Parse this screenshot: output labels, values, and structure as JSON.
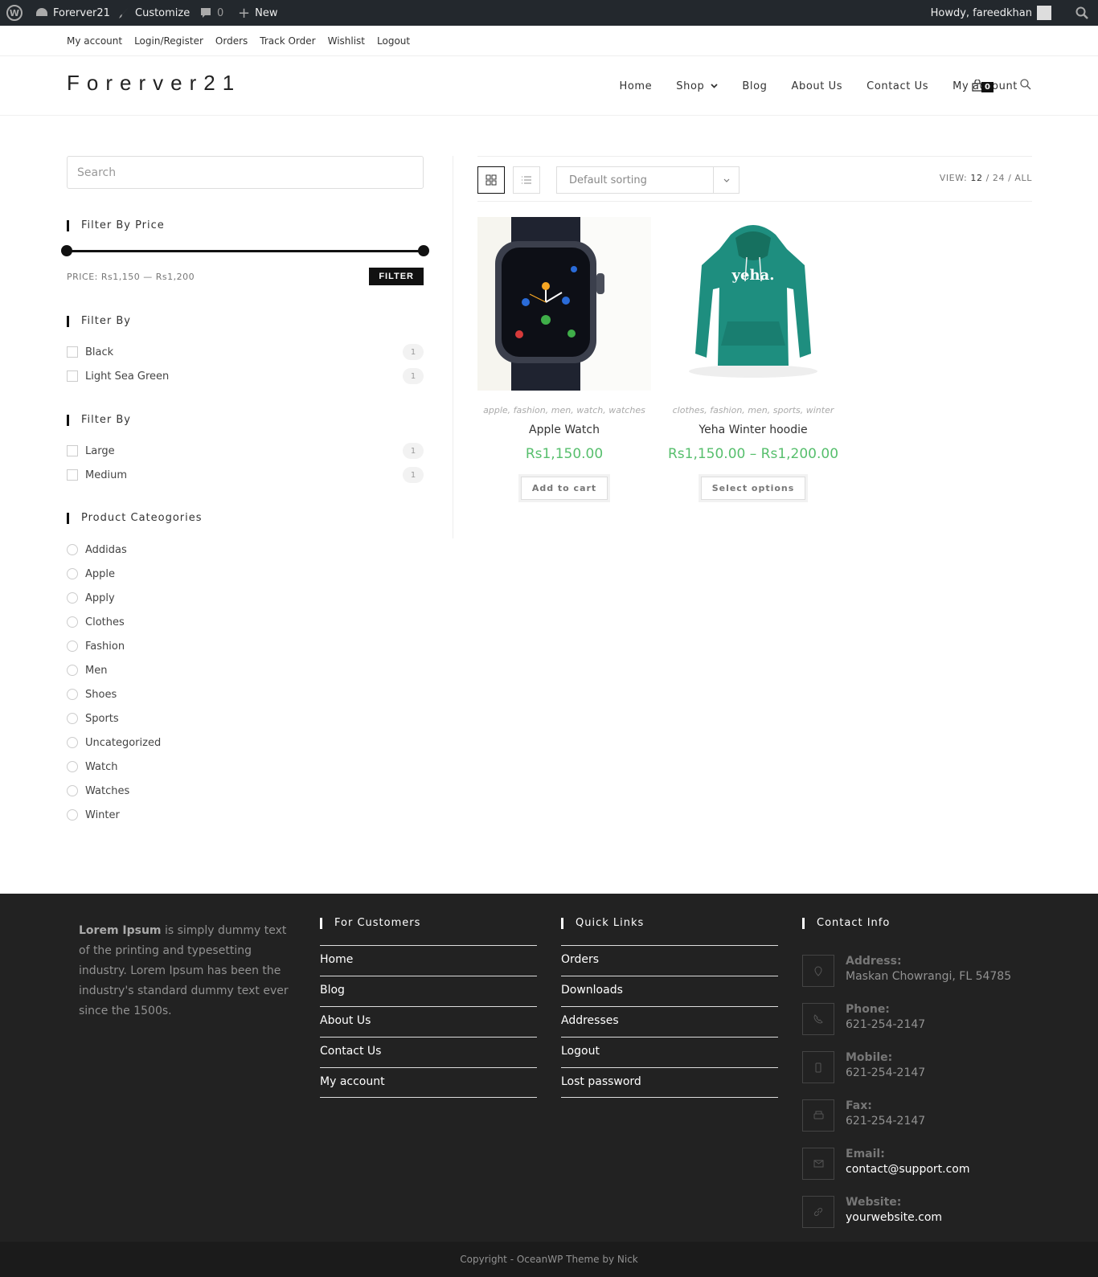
{
  "adminbar": {
    "site_name": "Forerver21",
    "customize": "Customize",
    "comments_count": "0",
    "new_label": "New",
    "howdy": "Howdy, fareedkhan"
  },
  "topbar": {
    "links": [
      "My account",
      "Login/Register",
      "Orders",
      "Track Order",
      "Wishlist",
      "Logout"
    ]
  },
  "header": {
    "logo": "Forerver21",
    "nav": [
      "Home",
      "Shop",
      "Blog",
      "About Us",
      "Contact Us",
      "My account"
    ],
    "cart_count": "0"
  },
  "sidebar": {
    "search_placeholder": "Search",
    "price_title": "Filter By Price",
    "price_label": "PRICE: Rs1,150 — Rs1,200",
    "price_range": [
      0,
      1
    ],
    "filter_button": "FILTER",
    "filter1_title": "Filter By",
    "filter1_items": [
      {
        "label": "Black",
        "count": "1"
      },
      {
        "label": "Light Sea Green",
        "count": "1"
      }
    ],
    "filter2_title": "Filter By",
    "filter2_items": [
      {
        "label": "Large",
        "count": "1"
      },
      {
        "label": "Medium",
        "count": "1"
      }
    ],
    "categories_title": "Product Cateogories",
    "categories": [
      "Addidas",
      "Apple",
      "Apply",
      "Clothes",
      "Fashion",
      "Men",
      "Shoes",
      "Sports",
      "Uncategorized",
      "Watch",
      "Watches",
      "Winter"
    ]
  },
  "toolbar": {
    "sort": "Default sorting",
    "view_label": "VIEW:",
    "view_12": "12",
    "view_24": "24",
    "view_all": "ALL"
  },
  "products": [
    {
      "cats": "apple, fashion, men, watch, watches",
      "title": "Apple Watch",
      "price": "Rs1,150.00",
      "button": "Add to cart"
    },
    {
      "cats": "clothes, fashion, men, sports, winter",
      "title": "Yeha Winter hoodie",
      "price": "Rs1,150.00 – Rs1,200.00",
      "button": "Select options",
      "print": "yeha."
    }
  ],
  "footer": {
    "about_bold": "Lorem Ipsum",
    "about_text": " is simply dummy text of the printing and typesetting industry. Lorem Ipsum has been the industry's standard dummy text ever since the 1500s.",
    "customers_title": "For Customers",
    "customers_links": [
      "Home",
      "Blog",
      "About Us",
      "Contact Us",
      "My account"
    ],
    "quick_title": "Quick Links",
    "quick_links": [
      "Orders",
      "Downloads",
      "Addresses",
      "Logout",
      "Lost password"
    ],
    "contact_title": "Contact Info",
    "contact": [
      {
        "label": "Address:",
        "value": "Maskan Chowrangi, FL 54785",
        "icon": "map-pin-icon"
      },
      {
        "label": "Phone:",
        "value": "621-254-2147",
        "icon": "phone-icon"
      },
      {
        "label": "Mobile:",
        "value": "621-254-2147",
        "icon": "mobile-icon"
      },
      {
        "label": "Fax:",
        "value": "621-254-2147",
        "icon": "fax-icon"
      },
      {
        "label": "Email:",
        "value": "contact@support.com",
        "icon": "envelope-icon"
      },
      {
        "label": "Website:",
        "value": "yourwebsite.com",
        "icon": "link-icon"
      }
    ],
    "copyright": "Copyright - OceanWP Theme by Nick"
  }
}
